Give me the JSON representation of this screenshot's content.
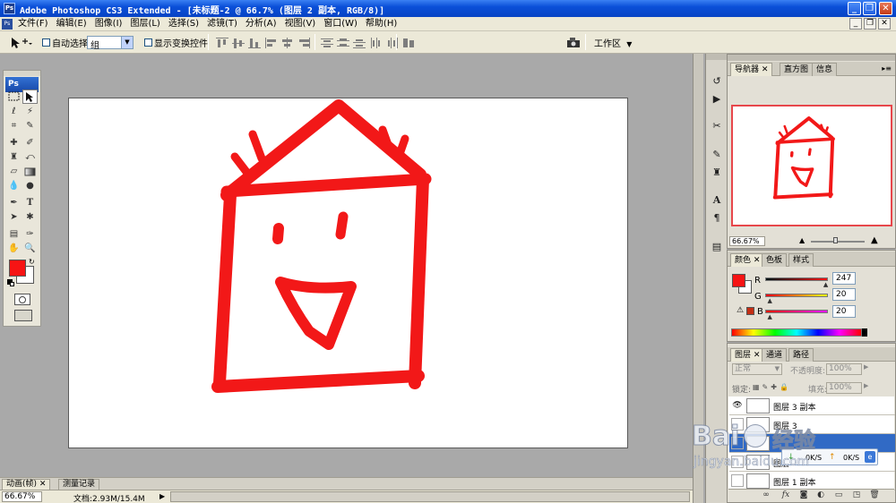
{
  "app": {
    "icon_text": "Ps",
    "window_title": "Adobe Photoshop CS3 Extended - [未标题-2 @ 66.7% (图层 2 副本, RGB/8)]",
    "window_buttons": [
      "_",
      "❐",
      "✕"
    ]
  },
  "menu": {
    "items": [
      "文件(F)",
      "编辑(E)",
      "图像(I)",
      "图层(L)",
      "选择(S)",
      "滤镜(T)",
      "分析(A)",
      "视图(V)",
      "窗口(W)",
      "帮助(H)"
    ],
    "doc_buttons": [
      "_",
      "❐",
      "✕"
    ]
  },
  "options": {
    "auto_select_label": "自动选择:",
    "auto_select_value": "组",
    "show_transform_label": "显示变换控件",
    "workspace_label": "工作区"
  },
  "tools": {
    "logo": "Ps"
  },
  "bottom": {
    "tab_animation": "动画(帧)",
    "tab_measure": "测量记录",
    "zoom": "66.67%",
    "doc_info": "文档:2.93M/15.4M"
  },
  "navigator": {
    "tabs": [
      "导航器",
      "直方图",
      "信息"
    ],
    "zoom": "66.67%"
  },
  "color_panel": {
    "tabs": [
      "颜色",
      "色板",
      "样式"
    ],
    "r_label": "R",
    "g_label": "G",
    "b_label": "B",
    "r_value": "247",
    "g_value": "20",
    "b_value": "20",
    "r_level": 0.969,
    "g_level": 0.078,
    "b_level": 0.078,
    "foreground_color": "#f71414",
    "background_color": "#ffffff"
  },
  "layers_panel": {
    "tabs": [
      "图层",
      "通道",
      "路径"
    ],
    "blend_mode": "正常",
    "opacity_label": "不透明度:",
    "opacity_value": "100%",
    "lock_label": "锁定:",
    "fill_label": "填充:",
    "fill_value": "100%",
    "layers": [
      {
        "name": "图层 3 副本",
        "visible": true,
        "selected": false
      },
      {
        "name": "图层 3",
        "visible": false,
        "selected": false
      },
      {
        "name": "",
        "visible": false,
        "selected": true
      },
      {
        "name": "图层",
        "visible": false,
        "selected": false
      },
      {
        "name": "图层 1 副本",
        "visible": false,
        "selected": false
      }
    ],
    "bottom_icons": [
      "link-icon",
      "fx-icon",
      "mask-icon",
      "adjustment-icon",
      "group-icon",
      "new-layer-icon",
      "trash-icon"
    ]
  },
  "net_popup": {
    "down": "0K/S",
    "up": "0K/S"
  },
  "watermark": {
    "brand": "Bai",
    "cn": "经验",
    "url": "jingyan.baidu.com"
  },
  "colors": {
    "drawing_red": "#f21818",
    "selection_blue": "#316ac5",
    "title_blue": "#0a4fd8"
  }
}
